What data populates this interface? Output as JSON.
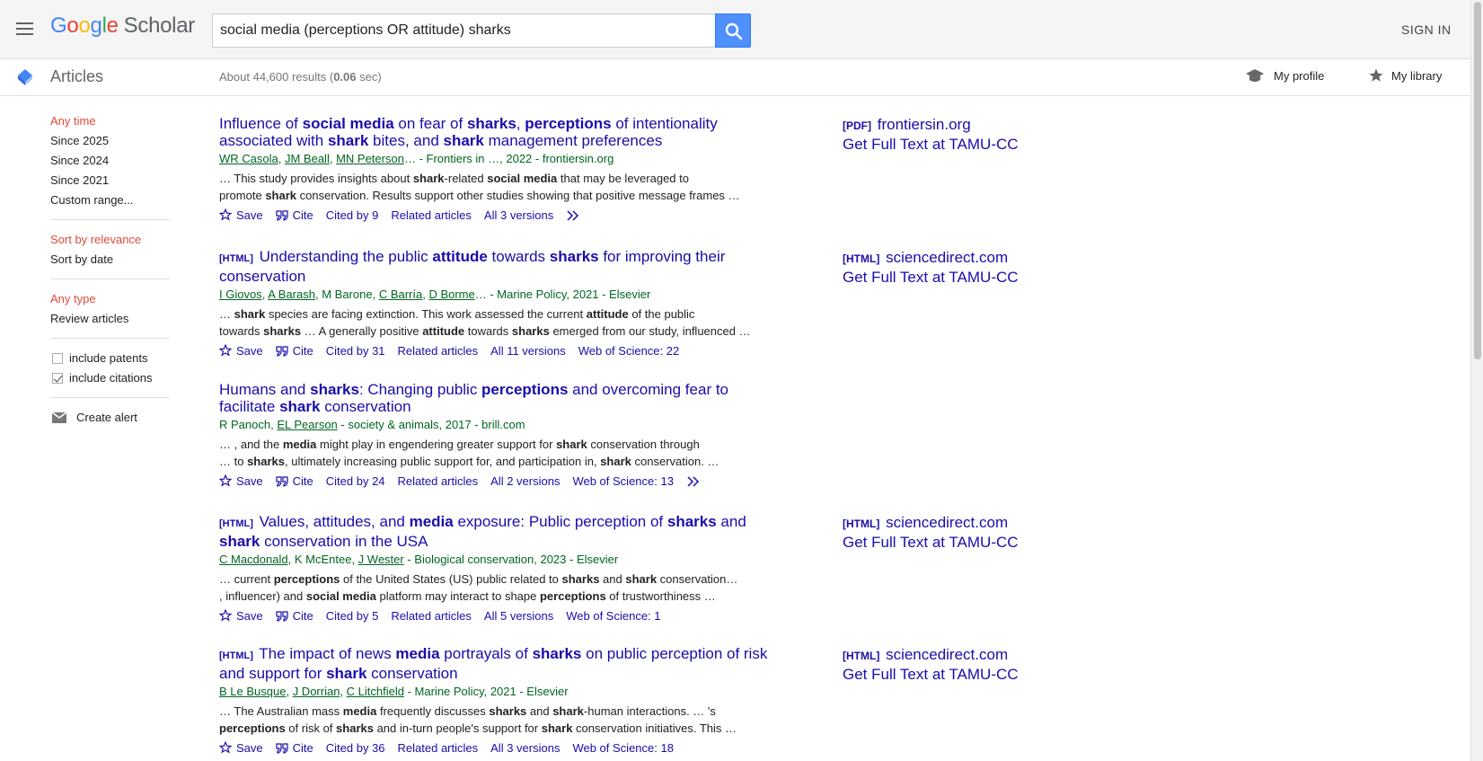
{
  "header": {
    "logo_letters": [
      "G",
      "o",
      "o",
      "g",
      "l",
      "e"
    ],
    "logo_product": "Scholar",
    "search_value": "social media (perceptions OR attitude) sharks",
    "sign_in": "SIGN IN"
  },
  "subheader": {
    "section": "Articles",
    "stats_prefix": "About 44,600 results (",
    "stats_time": "0.06",
    "stats_suffix": " sec)",
    "my_profile": "My profile",
    "my_library": "My library"
  },
  "sidebar": {
    "time": [
      "Any time",
      "Since 2025",
      "Since 2024",
      "Since 2021",
      "Custom range..."
    ],
    "sort": [
      "Sort by relevance",
      "Sort by date"
    ],
    "type": [
      "Any type",
      "Review articles"
    ],
    "include_patents": "include patents",
    "include_citations": "include citations",
    "create_alert": "Create alert"
  },
  "results": [
    {
      "type": "",
      "title_html": "Influence of <b>social media</b> on fear of <b>sharks</b>, <b>perceptions</b> of intentionality associated with <b>shark</b> bites, and <b>shark</b> management preferences",
      "authors": [
        "WR Casola",
        "JM Beall",
        "MN Peterson"
      ],
      "meta_tail": "… - Frontiers in …, 2022 - frontiersin.org",
      "snip1_html": "… This study provides insights about <b>shark</b>-related <b>social media</b> that may be leveraged to",
      "snip2_html": "promote <b>shark</b> conservation. Results support other studies showing that positive message frames …",
      "cited": "Cited by 9",
      "versions": "All 3 versions",
      "wos": "",
      "side_type": "[PDF]",
      "side_source": "frontiersin.org",
      "full_text": "Get Full Text at TAMU-CC"
    },
    {
      "type": "[HTML]",
      "title_html": "Understanding the public <b>attitude</b> towards <b>sharks</b> for improving their conservation",
      "authors": [
        "I Giovos",
        "A Barash",
        "M Barone",
        "C Barría",
        "D Borme"
      ],
      "meta_tail": "… - Marine Policy, 2021 - Elsevier",
      "snip1_html": "… <b>shark</b> species are facing extinction. This work assessed the current <b>attitude</b> of the public",
      "snip2_html": "towards <b>sharks</b> … A generally positive <b>attitude</b> towards <b>sharks</b> emerged from our study, influenced …",
      "cited": "Cited by 31",
      "versions": "All 11 versions",
      "wos": "Web of Science: 22",
      "side_type": "[HTML]",
      "side_source": "sciencedirect.com",
      "full_text": "Get Full Text at TAMU-CC"
    },
    {
      "type": "",
      "title_html": "Humans and <b>sharks</b>: Changing public <b>perceptions</b> and overcoming fear to facilitate <b>shark</b> conservation",
      "authors": [
        "R Panoch",
        "EL Pearson"
      ],
      "meta_tail": " - society & animals, 2017 - brill.com",
      "snip1_html": "… , and the <b>media</b> might play in engendering greater support for <b>shark</b> conservation through",
      "snip2_html": "… to <b>sharks</b>, ultimately increasing public support for, and participation in, <b>shark</b> conservation. …",
      "cited": "Cited by 24",
      "versions": "All 2 versions",
      "wos": "Web of Science: 13",
      "side_type": "",
      "side_source": "",
      "full_text": ""
    },
    {
      "type": "[HTML]",
      "title_html": "Values, attitudes, and <b>media</b> exposure: Public perception of <b>sharks</b> and <b>shark</b> conservation in the USA",
      "authors": [
        "C Macdonald",
        "K McEntee",
        "J Wester"
      ],
      "meta_tail": " - Biological conservation, 2023 - Elsevier",
      "snip1_html": "… current <b>perceptions</b> of the United States (US) public related to <b>sharks</b> and <b>shark</b> conservation…",
      "snip2_html": ", influencer) and <b>social media</b> platform may interact to shape <b>perceptions</b> of trustworthiness …",
      "cited": "Cited by 5",
      "versions": "All 5 versions",
      "wos": "Web of Science: 1",
      "side_type": "[HTML]",
      "side_source": "sciencedirect.com",
      "full_text": "Get Full Text at TAMU-CC"
    },
    {
      "type": "[HTML]",
      "title_html": "The impact of news <b>media</b> portrayals of <b>sharks</b> on public perception of risk and support for <b>shark</b> conservation",
      "authors": [
        "B Le Busque",
        "J Dorrian",
        "C Litchfield"
      ],
      "meta_tail": " - Marine Policy, 2021 - Elsevier",
      "snip1_html": "… The Australian mass <b>media</b> frequently discusses <b>sharks</b> and <b>shark</b>-human interactions. … 's",
      "snip2_html": "<b>perceptions</b> of risk of <b>sharks</b> and in-turn people's support for <b>shark</b> conservation initiatives. This …",
      "cited": "Cited by 36",
      "versions": "All 3 versions",
      "wos": "Web of Science: 18",
      "side_type": "[HTML]",
      "side_source": "sciencedirect.com",
      "full_text": "Get Full Text at TAMU-CC"
    }
  ],
  "actions": {
    "save": "Save",
    "cite": "Cite",
    "related": "Related articles"
  },
  "colors": {
    "link": "#1a0dab",
    "meta": "#006621",
    "selected": "#dd4b39",
    "search_button": "#4d90fe"
  }
}
